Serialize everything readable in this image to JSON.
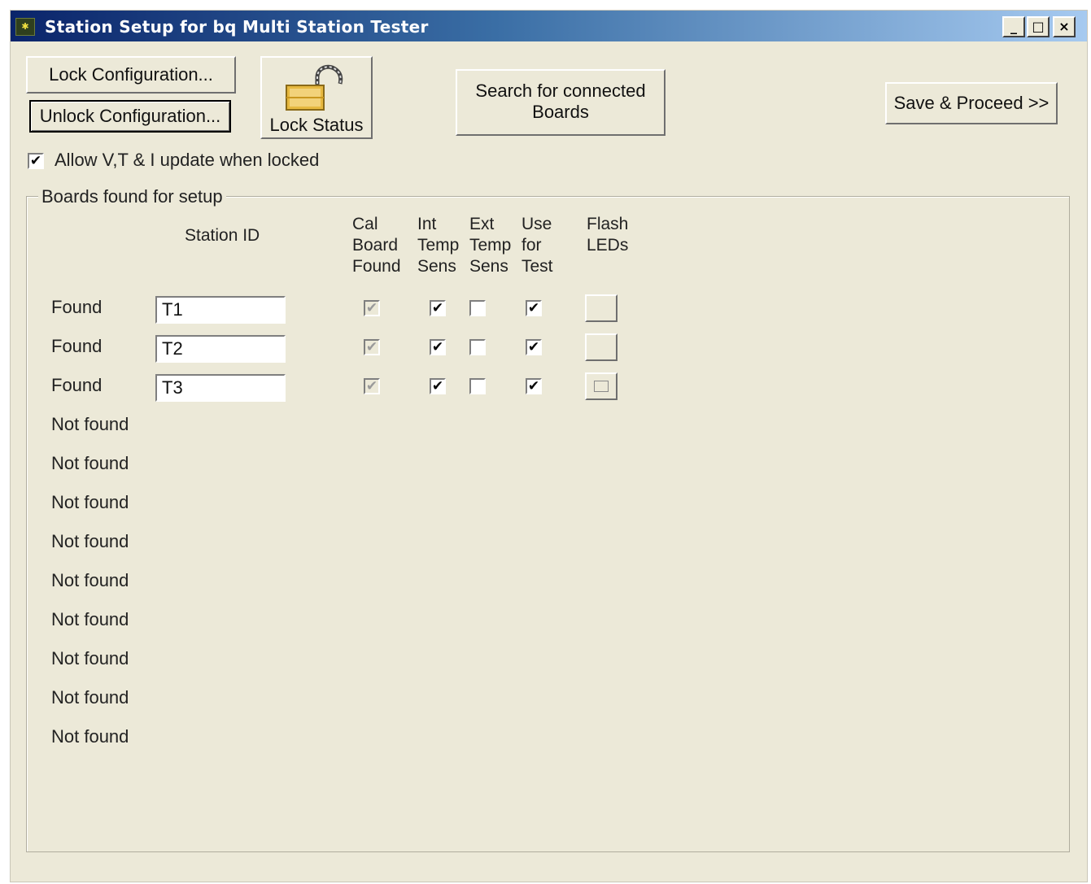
{
  "window": {
    "title": "Station Setup for bq Multi Station Tester",
    "controls": {
      "minimize": "_",
      "maximize": "□",
      "close": "×"
    }
  },
  "toolbar": {
    "lock_label": "Lock Configuration...",
    "unlock_label": "Unlock Configuration...",
    "lock_status_label": "Lock Status",
    "search_label_line1": "Search for connected",
    "search_label_line2": "Boards",
    "save_label": "Save & Proceed >>"
  },
  "allow_update": {
    "label": "Allow V,T & I update when locked",
    "checked": true
  },
  "group": {
    "title": "Boards found for setup",
    "columns": {
      "station_id": "Station ID",
      "cal_board": "Cal\nBoard\nFound",
      "int_temp": "Int\nTemp\nSens",
      "ext_temp": "Ext\nTemp\nSens",
      "use_test": "Use\nfor\nTest",
      "flash": "Flash\nLEDs"
    },
    "rows": [
      {
        "status": "Found",
        "station_id": "T1",
        "cal": true,
        "int": true,
        "ext": false,
        "use": true
      },
      {
        "status": "Found",
        "station_id": "T2",
        "cal": true,
        "int": true,
        "ext": false,
        "use": true
      },
      {
        "status": "Found",
        "station_id": "T3",
        "cal": true,
        "int": true,
        "ext": false,
        "use": true
      },
      {
        "status": "Not found"
      },
      {
        "status": "Not found"
      },
      {
        "status": "Not found"
      },
      {
        "status": "Not found"
      },
      {
        "status": "Not found"
      },
      {
        "status": "Not found"
      },
      {
        "status": "Not found"
      },
      {
        "status": "Not found"
      },
      {
        "status": "Not found"
      }
    ]
  },
  "icons": {
    "app": "app-icon",
    "lock": "padlock-icon"
  }
}
